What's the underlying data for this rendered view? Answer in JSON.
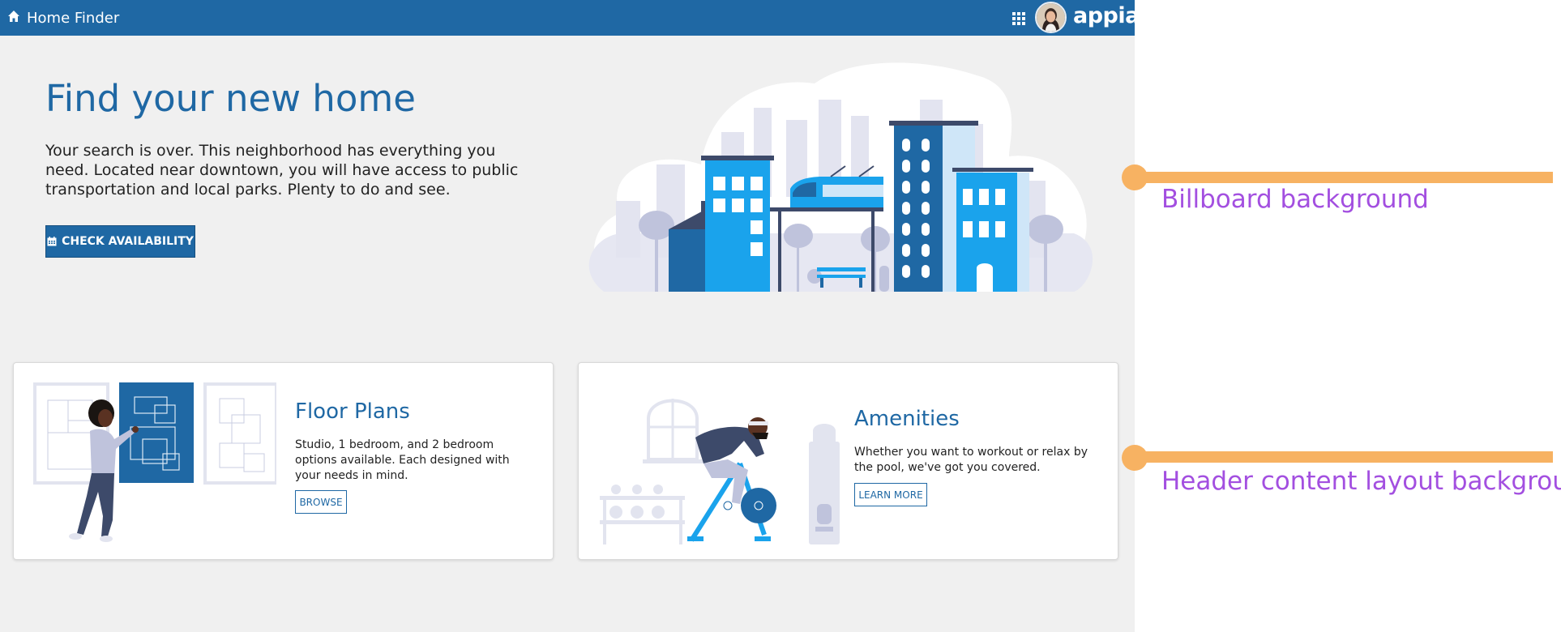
{
  "topbar": {
    "app_name": "Home Finder",
    "brand": "appian",
    "icons": {
      "home": "home-icon",
      "apps": "grid-icon",
      "avatar": "user-avatar"
    },
    "color": "#1f68a4"
  },
  "billboard": {
    "title": "Find your new home",
    "text": "Your search is over. This neighborhood has everything you need. Located near downtown, you will have access to public transportation and local parks. Plenty to do and see.",
    "button_label": "CHECK AVAILABILITY",
    "button_icon": "calendar-icon"
  },
  "cards": [
    {
      "title": "Floor Plans",
      "text": "Studio, 1 bedroom, and 2 bedroom options available. Each designed with your needs in mind.",
      "button_label": "BROWSE"
    },
    {
      "title": "Amenities",
      "text": "Whether you want to workout or relax by the pool, we've got you covered.",
      "button_label": "LEARN MORE"
    }
  ],
  "annotations": [
    {
      "label": "Billboard background"
    },
    {
      "label": "Header content layout background"
    }
  ],
  "colors": {
    "accent": "#1f68a4",
    "app_background": "#f0f0f0",
    "annotation_line": "#f7b262",
    "annotation_text": "#a34fe0"
  }
}
